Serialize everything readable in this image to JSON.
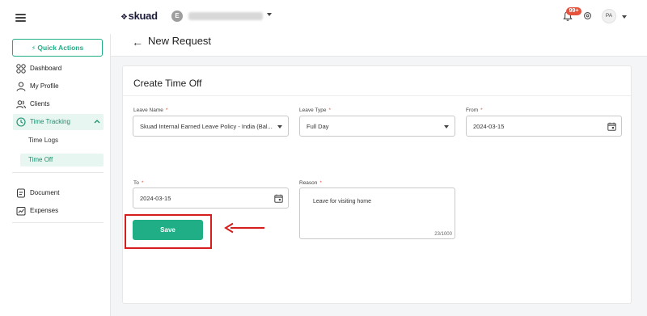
{
  "app": {
    "logo_text": "skuad",
    "org_initial": "E",
    "notification_badge": "99+",
    "user_initials": "PA"
  },
  "sidebar": {
    "quick_actions": "Quick Actions",
    "items": [
      {
        "label": "Dashboard",
        "icon": "grid-icon"
      },
      {
        "label": "My Profile",
        "icon": "person-icon"
      },
      {
        "label": "Clients",
        "icon": "users-icon"
      },
      {
        "label": "Time Tracking",
        "icon": "clock-icon"
      }
    ],
    "sub_items": [
      {
        "label": "Time Logs"
      },
      {
        "label": "Time Off"
      }
    ],
    "bottom_items": [
      {
        "label": "Document",
        "icon": "document-icon"
      },
      {
        "label": "Expenses",
        "icon": "chart-icon"
      }
    ]
  },
  "page": {
    "title": "New Request"
  },
  "form": {
    "title": "Create Time Off",
    "leave_name": {
      "label": "Leave Name",
      "value": "Skuad Internal Earned Leave Policy - India (Bal..."
    },
    "leave_type": {
      "label": "Leave Type",
      "value": "Full Day"
    },
    "from": {
      "label": "From",
      "value": "2024-03-15"
    },
    "to": {
      "label": "To",
      "value": "2024-03-15"
    },
    "reason": {
      "label": "Reason",
      "value": "Leave for visiting home",
      "counter": "23/1000"
    },
    "required_mark": "*",
    "save_label": "Save"
  },
  "colors": {
    "accent": "#1fae86",
    "highlight": "#d61e1e",
    "badge": "#e5533d"
  }
}
